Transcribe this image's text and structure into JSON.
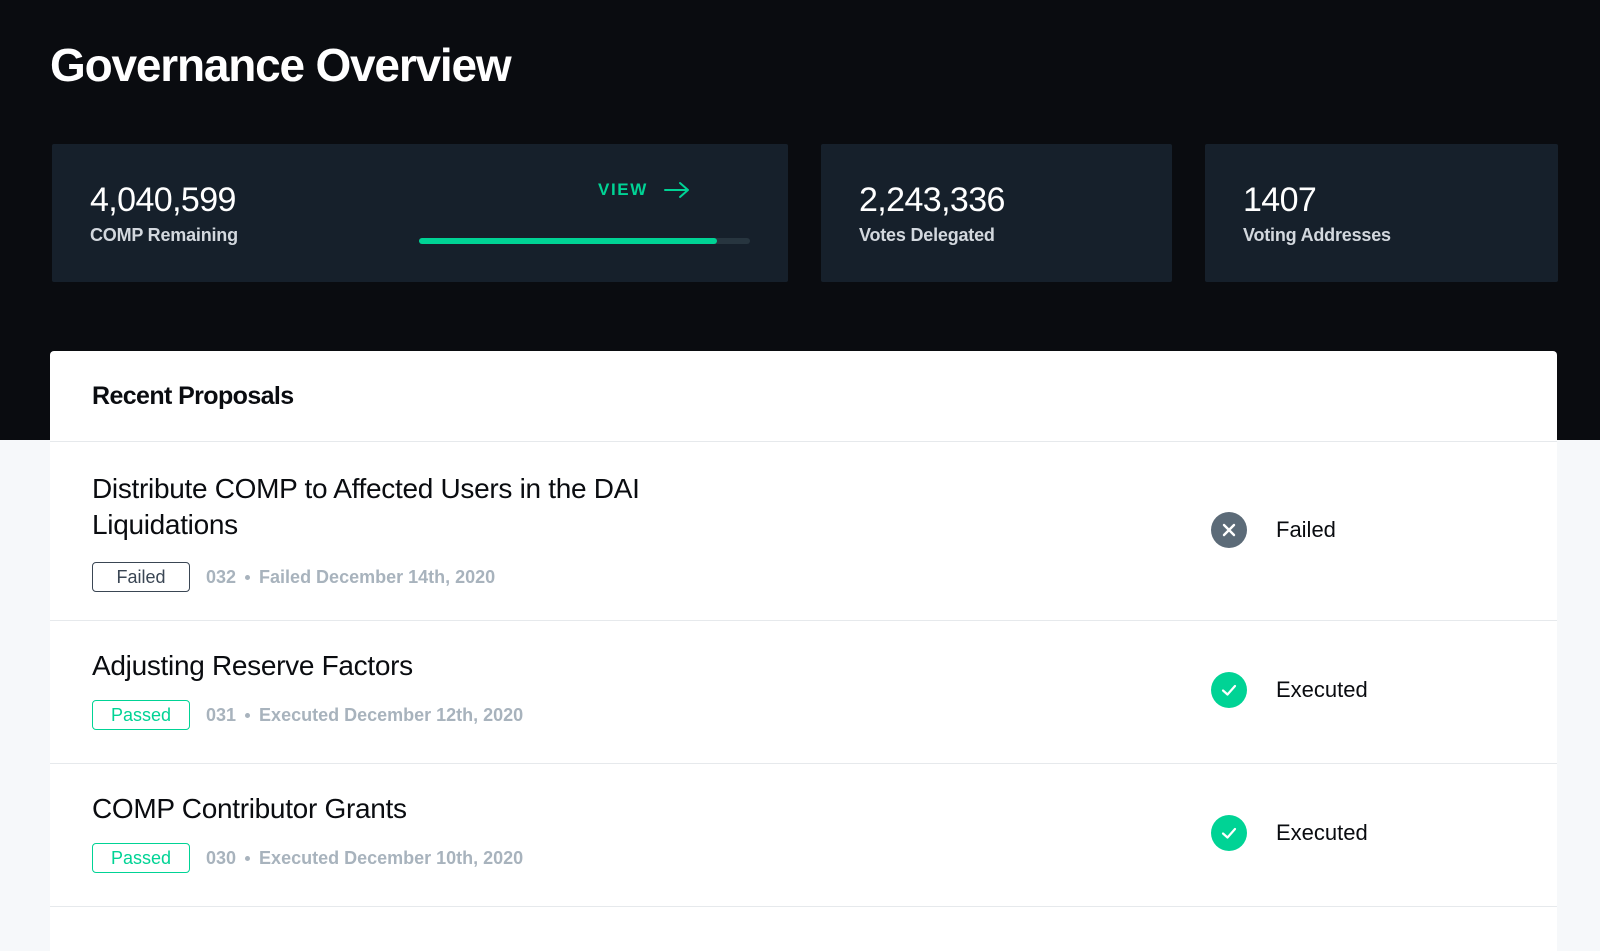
{
  "page": {
    "title": "Governance Overview"
  },
  "stats": [
    {
      "value": "4,040,599",
      "label": "COMP Remaining"
    },
    {
      "value": "2,243,336",
      "label": "Votes Delegated"
    },
    {
      "value": "1407",
      "label": "Voting Addresses"
    }
  ],
  "view_link": {
    "label": "VIEW",
    "icon": "arrow-right-icon"
  },
  "comp_progress": {
    "fraction": 0.9
  },
  "proposals_panel": {
    "title": "Recent Proposals",
    "items": [
      {
        "title": "Distribute COMP to Affected Users in the DAI Liquidations",
        "badge": "Failed",
        "id": "032",
        "meta": "Failed December 14th, 2020",
        "status_icon": "close-icon",
        "status": "Failed"
      },
      {
        "title": "Adjusting Reserve Factors",
        "badge": "Passed",
        "id": "031",
        "meta": "Executed December 12th, 2020",
        "status_icon": "check-icon",
        "status": "Executed"
      },
      {
        "title": "COMP Contributor Grants",
        "badge": "Passed",
        "id": "030",
        "meta": "Executed December 10th, 2020",
        "status_icon": "check-icon",
        "status": "Executed"
      }
    ]
  },
  "colors": {
    "accent": "#00d395",
    "hero_background": "#0a0c10",
    "card_background": "#16202b",
    "failed_gray": "#5c6b78"
  }
}
